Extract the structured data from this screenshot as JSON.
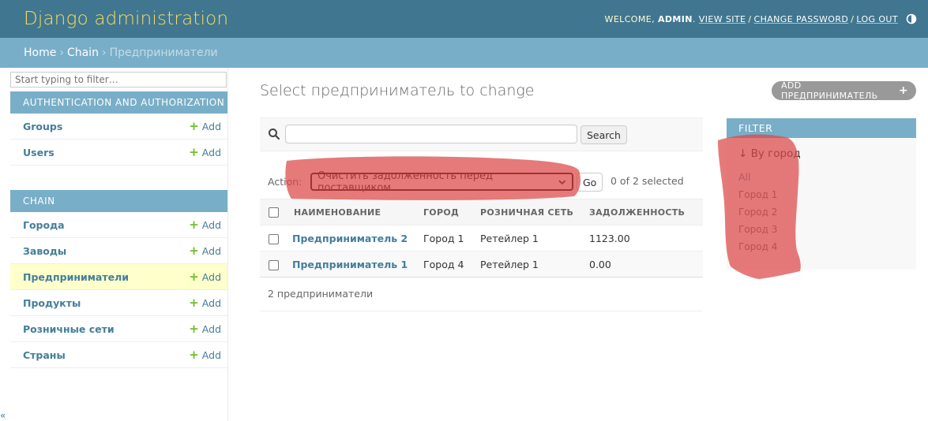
{
  "header": {
    "site_name": "Django administration",
    "welcome": "WELCOME,",
    "username": "ADMIN",
    "view_site": "VIEW SITE",
    "change_password": "CHANGE PASSWORD",
    "log_out": "LOG OUT",
    "theme_icon": "theme-toggle-icon"
  },
  "breadcrumbs": {
    "home": "Home",
    "app": "Chain",
    "current": "Предприниматели",
    "separator": "›"
  },
  "sidebar": {
    "filter_placeholder": "Start typing to filter…",
    "add_label": "Add",
    "modules": [
      {
        "caption": "AUTHENTICATION AND AUTHORIZATION",
        "models": [
          {
            "label": "Groups"
          },
          {
            "label": "Users"
          }
        ]
      },
      {
        "caption": "CHAIN",
        "models": [
          {
            "label": "Города"
          },
          {
            "label": "Заводы"
          },
          {
            "label": "Предприниматели",
            "current": true
          },
          {
            "label": "Продукты"
          },
          {
            "label": "Розничные сети"
          },
          {
            "label": "Страны"
          }
        ]
      }
    ],
    "collapse_glyph": "«"
  },
  "content": {
    "title": "Select предприниматель to change",
    "add_button": "ADD ПРЕДПРИНИМАТЕЛЬ",
    "search_button": "Search",
    "action_label": "Action:",
    "action_selected": "Очистить задолженность перед поставщиком",
    "go_button": "Go",
    "selection_count": "0 of 2 selected",
    "table": {
      "headers": [
        "НАИМЕНОВАНИЕ",
        "ГОРОД",
        "РОЗНИЧНАЯ СЕТЬ",
        "ЗАДОЛЖЕННОСТЬ"
      ],
      "rows": [
        [
          "Предприниматель 2",
          "Город 1",
          "Ретейлер 1",
          "1123.00"
        ],
        [
          "Предприниматель 1",
          "Город 4",
          "Ретейлер 1",
          "0.00"
        ]
      ]
    },
    "paginator": "2 предприниматели"
  },
  "filter": {
    "title": "FILTER",
    "by": "↓ By город",
    "items": [
      "All",
      "Город 1",
      "Город 2",
      "Город 3",
      "Город 4"
    ]
  },
  "colors": {
    "header_bg": "#417690",
    "branding": "#f5dd5d",
    "breadcrumb_bg": "#79aec8",
    "link": "#447e9b",
    "add_icon": "#70bf2b",
    "highlight_row": "#ffffcc",
    "annotation_red": "#dc4646"
  }
}
